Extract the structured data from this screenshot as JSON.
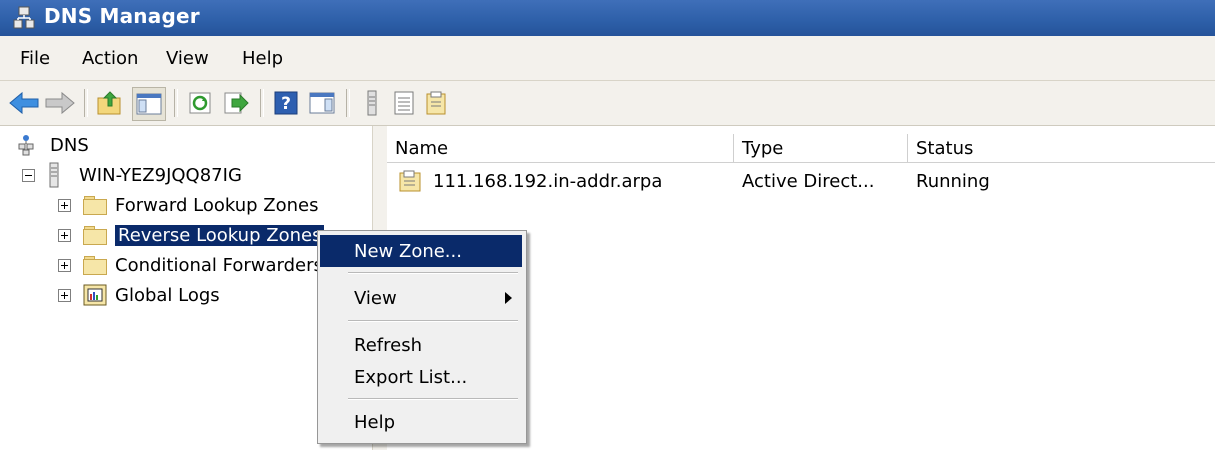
{
  "window": {
    "title": "DNS Manager"
  },
  "menubar": [
    "File",
    "Action",
    "View",
    "Help"
  ],
  "toolbar": {
    "icons": [
      "back-icon",
      "forward-icon",
      "up-folder-icon",
      "show-hide-tree-icon",
      "refresh-icon",
      "export-list-icon",
      "help-icon",
      "action-pane-icon",
      "server-icon",
      "list-icon",
      "properties-icon"
    ]
  },
  "tree": {
    "root": "DNS",
    "server": "WIN-YEZ9JQQ87IG",
    "nodes": [
      "Forward Lookup Zones",
      "Reverse Lookup Zones",
      "Conditional Forwarders",
      "Global Logs"
    ]
  },
  "list": {
    "columns": [
      "Name",
      "Type",
      "Status"
    ],
    "rows": [
      {
        "name": "111.168.192.in-addr.arpa",
        "type": "Active Direct...",
        "status": "Running"
      }
    ]
  },
  "context_menu": {
    "items": [
      "New Zone...",
      "View",
      "Refresh",
      "Export List...",
      "Help"
    ]
  },
  "colors": {
    "title_bar": "#2d5fa8",
    "selection": "#0a2a6a",
    "chrome": "#f3f1ec"
  }
}
